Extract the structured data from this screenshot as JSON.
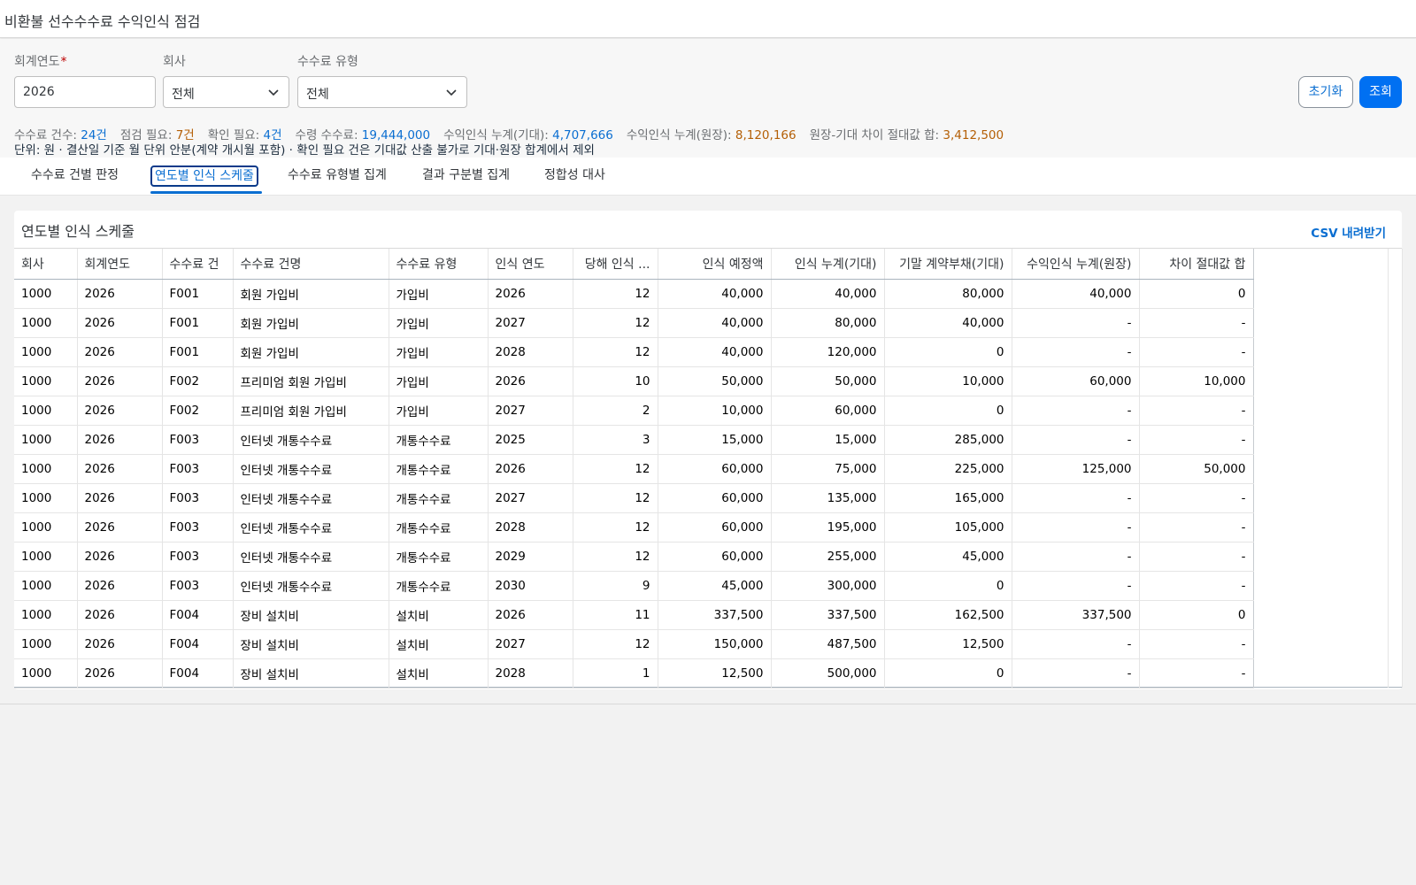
{
  "app": {
    "title": "비환불 선수수수료 수익인식 점검"
  },
  "filters": {
    "fiscal_year": {
      "label": "회계연도",
      "required_mark": "*",
      "value": "2026"
    },
    "company": {
      "label": "회사",
      "value": "전체"
    },
    "fee_type": {
      "label": "수수료 유형",
      "value": "전체"
    },
    "reset_label": "초기화",
    "search_label": "조회"
  },
  "summary": {
    "fee_count_label": "수수료 건수:",
    "fee_count_value": "24건",
    "check_needed_label": "점검 필요:",
    "check_needed_value": "7건",
    "confirm_needed_label": "확인 필요:",
    "confirm_needed_value": "4건",
    "received_label": "수령 수수료:",
    "received_value": "19,444,000",
    "rev_expected_label": "수익인식 누계(기대):",
    "rev_expected_value": "4,707,666",
    "rev_ledger_label": "수익인식 누계(원장):",
    "rev_ledger_value": "8,120,166",
    "diff_label": "원장-기대 차이 절대값 합:",
    "diff_value": "3,412,500",
    "notice": "단위: 원 · 결산일 기준 월 단위 안분(계약 개시월 포함) · 확인 필요 건은 기대값 산출 불가로 기대·원장 합계에서 제외"
  },
  "tabs": [
    {
      "label": "수수료 건별 판정",
      "active": false
    },
    {
      "label": "연도별 인식 스케줄",
      "active": true
    },
    {
      "label": "수수료 유형별 집계",
      "active": false
    },
    {
      "label": "결과 구분별 집계",
      "active": false
    },
    {
      "label": "정합성 대사",
      "active": false
    }
  ],
  "panel": {
    "title": "연도별 인식 스케줄",
    "csv_label": "CSV 내려받기"
  },
  "table": {
    "columns": [
      "회사",
      "회계연도",
      "수수료 건",
      "수수료 건명",
      "수수료 유형",
      "인식 연도",
      "당해 인식 ...",
      "인식 예정액",
      "인식 누계(기대)",
      "기말 계약부채(기대)",
      "수익인식 누계(원장)",
      "차이 절대값 합"
    ],
    "rows": [
      [
        "1000",
        "2026",
        "F001",
        "회원 가입비",
        "가입비",
        "2026",
        "12",
        "40,000",
        "40,000",
        "80,000",
        "40,000",
        "0"
      ],
      [
        "1000",
        "2026",
        "F001",
        "회원 가입비",
        "가입비",
        "2027",
        "12",
        "40,000",
        "80,000",
        "40,000",
        "-",
        "-"
      ],
      [
        "1000",
        "2026",
        "F001",
        "회원 가입비",
        "가입비",
        "2028",
        "12",
        "40,000",
        "120,000",
        "0",
        "-",
        "-"
      ],
      [
        "1000",
        "2026",
        "F002",
        "프리미엄 회원 가입비",
        "가입비",
        "2026",
        "10",
        "50,000",
        "50,000",
        "10,000",
        "60,000",
        "10,000"
      ],
      [
        "1000",
        "2026",
        "F002",
        "프리미엄 회원 가입비",
        "가입비",
        "2027",
        "2",
        "10,000",
        "60,000",
        "0",
        "-",
        "-"
      ],
      [
        "1000",
        "2026",
        "F003",
        "인터넷 개통수수료",
        "개통수수료",
        "2025",
        "3",
        "15,000",
        "15,000",
        "285,000",
        "-",
        "-"
      ],
      [
        "1000",
        "2026",
        "F003",
        "인터넷 개통수수료",
        "개통수수료",
        "2026",
        "12",
        "60,000",
        "75,000",
        "225,000",
        "125,000",
        "50,000"
      ],
      [
        "1000",
        "2026",
        "F003",
        "인터넷 개통수수료",
        "개통수수료",
        "2027",
        "12",
        "60,000",
        "135,000",
        "165,000",
        "-",
        "-"
      ],
      [
        "1000",
        "2026",
        "F003",
        "인터넷 개통수수료",
        "개통수수료",
        "2028",
        "12",
        "60,000",
        "195,000",
        "105,000",
        "-",
        "-"
      ],
      [
        "1000",
        "2026",
        "F003",
        "인터넷 개통수수료",
        "개통수수료",
        "2029",
        "12",
        "60,000",
        "255,000",
        "45,000",
        "-",
        "-"
      ],
      [
        "1000",
        "2026",
        "F003",
        "인터넷 개통수수료",
        "개통수수료",
        "2030",
        "9",
        "45,000",
        "300,000",
        "0",
        "-",
        "-"
      ],
      [
        "1000",
        "2026",
        "F004",
        "장비 설치비",
        "설치비",
        "2026",
        "11",
        "337,500",
        "337,500",
        "162,500",
        "337,500",
        "0"
      ],
      [
        "1000",
        "2026",
        "F004",
        "장비 설치비",
        "설치비",
        "2027",
        "12",
        "150,000",
        "487,500",
        "12,500",
        "-",
        "-"
      ],
      [
        "1000",
        "2026",
        "F004",
        "장비 설치비",
        "설치비",
        "2028",
        "1",
        "12,500",
        "500,000",
        "0",
        "-",
        "-"
      ]
    ]
  },
  "colors": {
    "accent": "#0a6ed1",
    "primary_button": "#0070f2",
    "warning": "#b45f06"
  }
}
